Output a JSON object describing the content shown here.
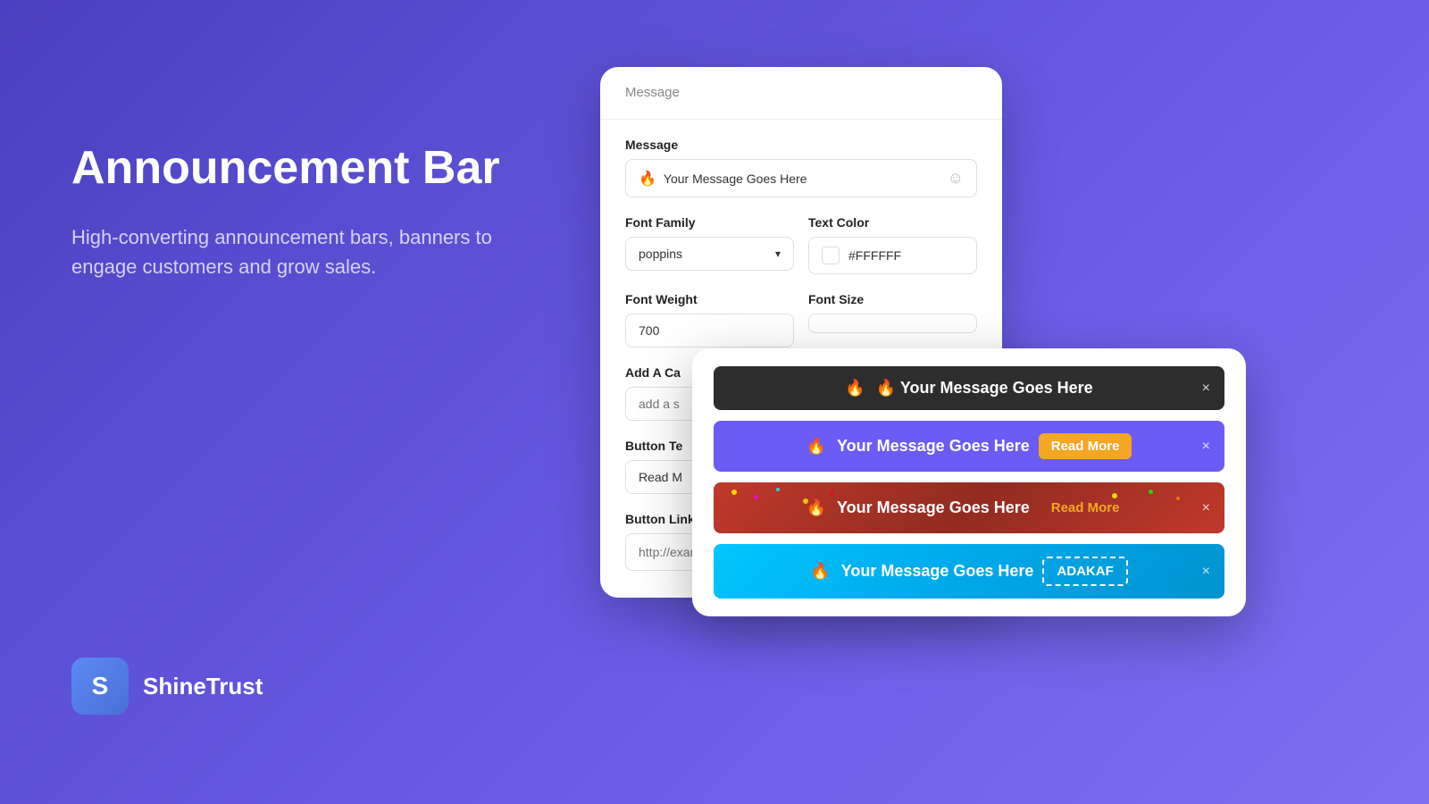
{
  "page": {
    "background": "gradient-purple-blue"
  },
  "left": {
    "title": "Announcement Bar",
    "description": "High-converting announcement bars, banners to engage customers and grow sales."
  },
  "brand": {
    "icon": "S",
    "name": "ShineTrust"
  },
  "form_card": {
    "header_label": "Message",
    "message_section_label": "Message",
    "message_value": "Your Message Goes Here",
    "message_emoji_icon": "☺",
    "font_family_label": "Font Family",
    "font_family_value": "poppins",
    "font_family_chevron": "▾",
    "text_color_label": "Text Color",
    "text_color_swatch": "#FFFFFF",
    "text_color_value": "#FFFFFF",
    "font_weight_label": "Font Weight",
    "font_weight_value": "700",
    "font_size_label": "Font Size",
    "font_size_value": "",
    "cta_label": "Add A Ca",
    "cta_placeholder": "add a s",
    "button_text_label": "Button Te",
    "button_text_value": "Read M",
    "button_link_label": "Button Link URL",
    "button_link_placeholder": "http://example.com"
  },
  "preview_card": {
    "bars": [
      {
        "id": "bar-dark",
        "style": "dark",
        "message": "🔥 Your Message Goes Here",
        "close_label": "×",
        "has_cta": false
      },
      {
        "id": "bar-purple",
        "style": "purple",
        "message": "🔥 Your Message Goes Here",
        "cta_label": "Read More",
        "close_label": "×",
        "has_cta": true
      },
      {
        "id": "bar-red",
        "style": "red-confetti",
        "message": "🔥 Your Message Goes Here",
        "cta_label": "Read More",
        "close_label": "×",
        "has_cta": true
      },
      {
        "id": "bar-cyan",
        "style": "cyan",
        "message": "🔥 Your Message Goes Here",
        "cta_label": "ADAKAF",
        "close_label": "×",
        "has_cta": true,
        "cta_dashed": true
      }
    ]
  }
}
